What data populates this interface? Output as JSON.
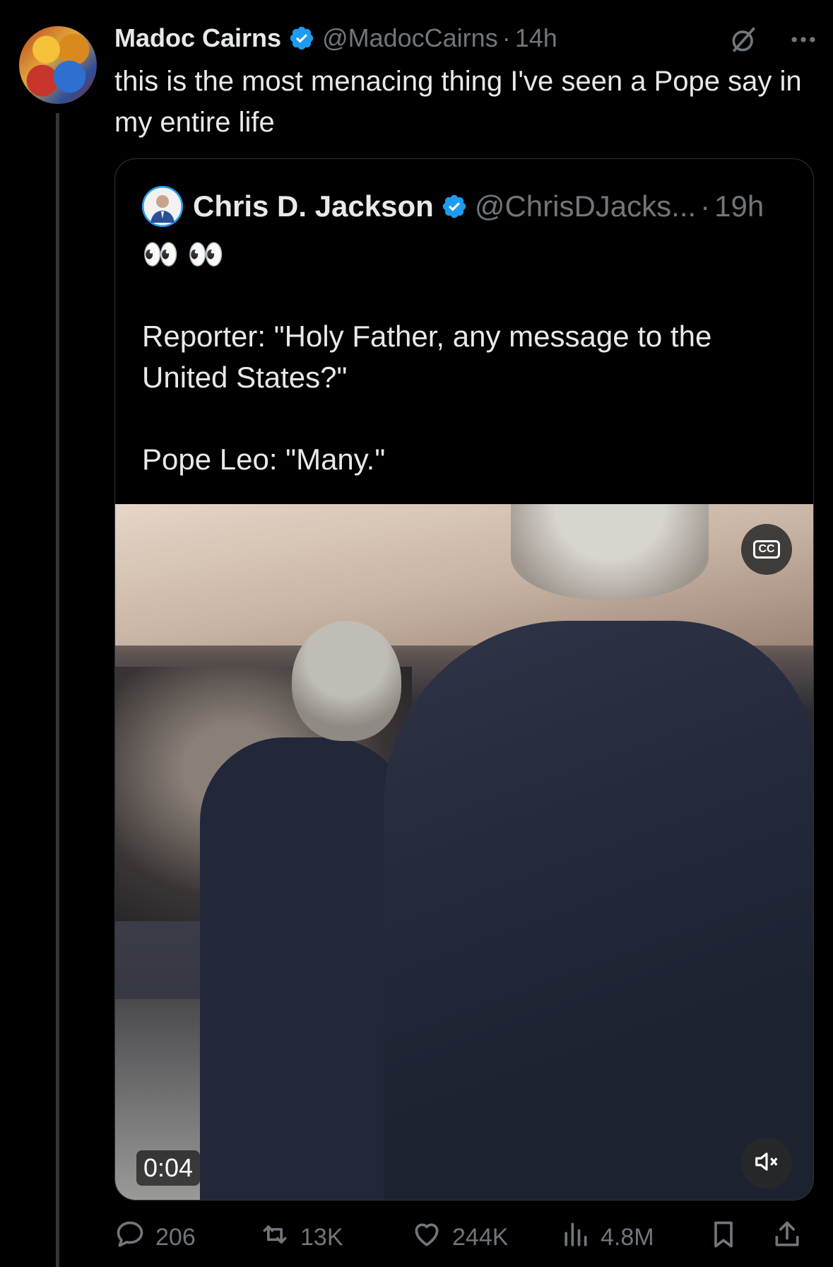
{
  "author": {
    "name": "Madoc Cairns",
    "handle": "@MadocCairns",
    "separator": "·",
    "time": "14h",
    "verified": true
  },
  "tweet": {
    "text": "this is the most menacing thing I've seen a Pope say in my entire life"
  },
  "quote": {
    "name": "Chris D. Jackson",
    "handle": "@ChrisDJacks...",
    "separator": "·",
    "time": "19h",
    "verified": true,
    "emoji": "👀 👀",
    "line1": "Reporter: \"Holy Father, any message to the United States?\"",
    "line2": "Pope Leo: \"Many.\"",
    "video": {
      "timestamp": "0:04",
      "cc_label": "CC",
      "muted": true
    }
  },
  "actions": {
    "replies": "206",
    "reposts": "13K",
    "likes": "244K",
    "views": "4.8M"
  },
  "colors": {
    "background": "#000000",
    "text": "#e7e9ea",
    "muted": "#71767b",
    "verified": "#1d9bf0",
    "border": "#2f3336"
  },
  "icons": [
    "verified-badge-icon",
    "grok-icon",
    "more-icon",
    "cc-icon",
    "mute-icon",
    "reply-icon",
    "repost-icon",
    "like-icon",
    "views-icon",
    "bookmark-icon",
    "share-icon"
  ]
}
